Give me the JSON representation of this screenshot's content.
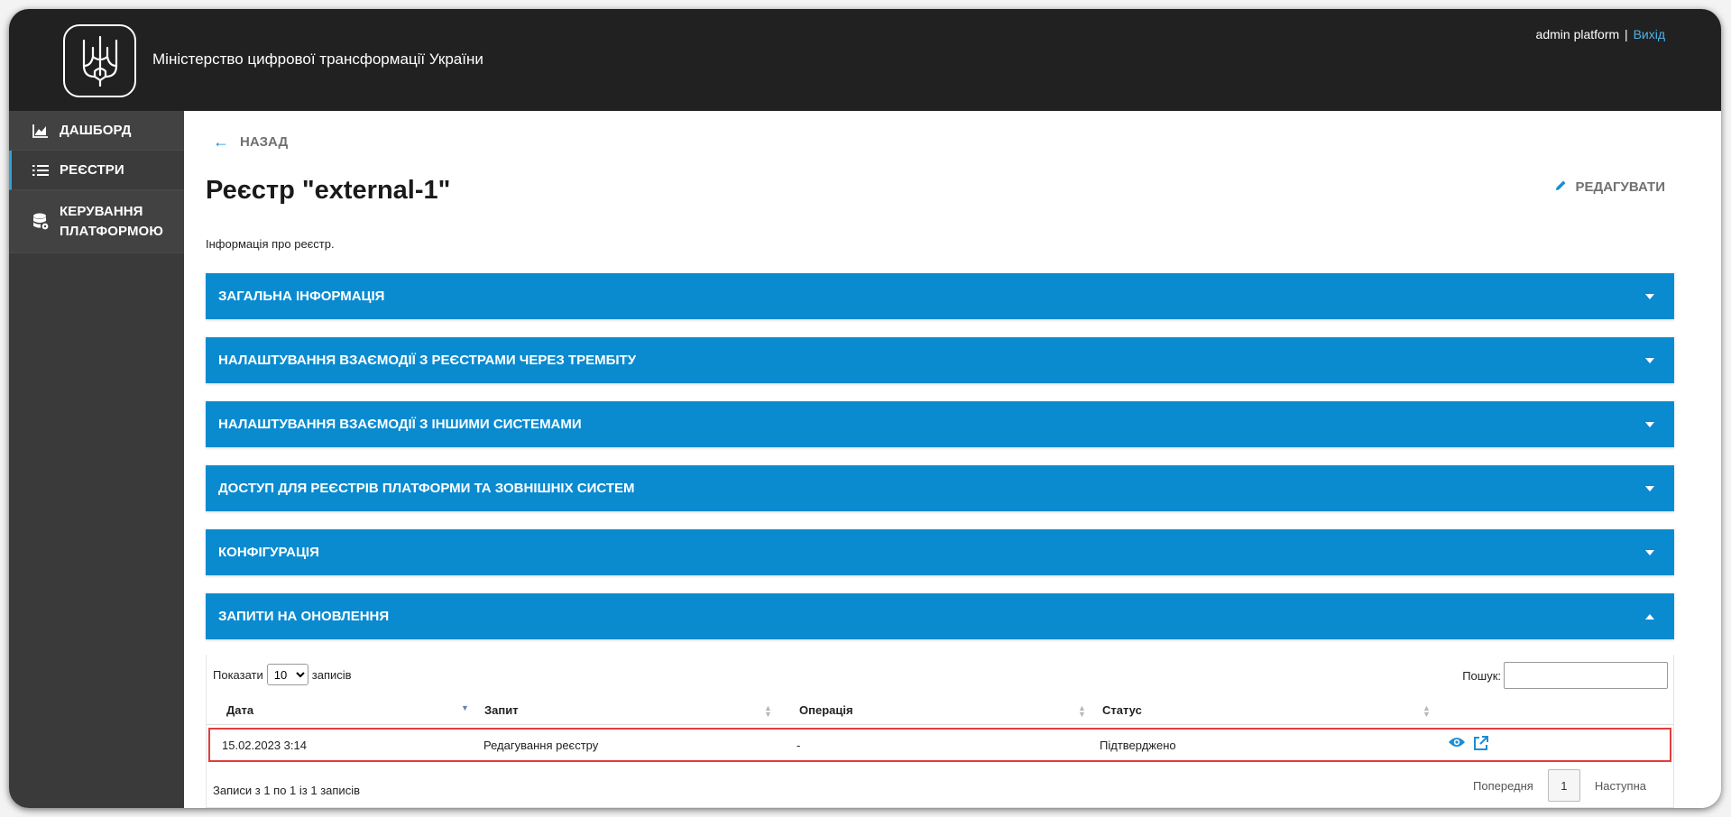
{
  "header": {
    "org_title": "Міністерство цифрової трансформації України",
    "user_name": "admin platform",
    "separator": "|",
    "logout_label": "Вихід"
  },
  "sidebar": {
    "items": [
      {
        "label": "ДАШБОРД",
        "icon": "chart-icon"
      },
      {
        "label": "РЕЄСТРИ",
        "icon": "list-icon"
      },
      {
        "label_line1": "КЕРУВАННЯ",
        "label_line2": "ПЛАТФОРМОЮ",
        "icon": "database-settings-icon"
      }
    ]
  },
  "main": {
    "back_label": "НАЗАД",
    "title": "Реєстр \"external-1\"",
    "edit_label": "РЕДАГУВАТИ",
    "subtitle": "Інформація про реєстр.",
    "panels": [
      {
        "title": "ЗАГАЛЬНА ІНФОРМАЦІЯ",
        "expanded": false
      },
      {
        "title": "НАЛАШТУВАННЯ ВЗАЄМОДІЇ З РЕЄСТРАМИ ЧЕРЕЗ ТРЕМБІТУ",
        "expanded": false
      },
      {
        "title": "НАЛАШТУВАННЯ ВЗАЄМОДІЇ З ІНШИМИ СИСТЕМАМИ",
        "expanded": false
      },
      {
        "title": "ДОСТУП ДЛЯ РЕЄСТРІВ ПЛАТФОРМИ ТА ЗОВНІШНІХ СИСТЕМ",
        "expanded": false
      },
      {
        "title": "КОНФІГУРАЦІЯ",
        "expanded": false
      },
      {
        "title": "ЗАПИТИ НА ОНОВЛЕННЯ",
        "expanded": true
      }
    ],
    "table": {
      "show_label": "Показати",
      "page_size": "10",
      "records_label": "записів",
      "search_label": "Пошук:",
      "columns": [
        "Дата",
        "Запит",
        "Операція",
        "Статус"
      ],
      "rows": [
        {
          "date": "15.02.2023 3:14",
          "request": "Редагування реєстру",
          "operation": "-",
          "status": "Підтверджено"
        }
      ],
      "info": "Записи з 1 по 1 із 1 записів",
      "prev_label": "Попередня",
      "current_page": "1",
      "next_label": "Наступна"
    }
  },
  "colors": {
    "header_bg": "#212121",
    "sidebar_bg": "#3a3a3a",
    "accent": "#0a8bd0",
    "link": "#4fb3e8",
    "highlight_border": "#e23c3c"
  }
}
